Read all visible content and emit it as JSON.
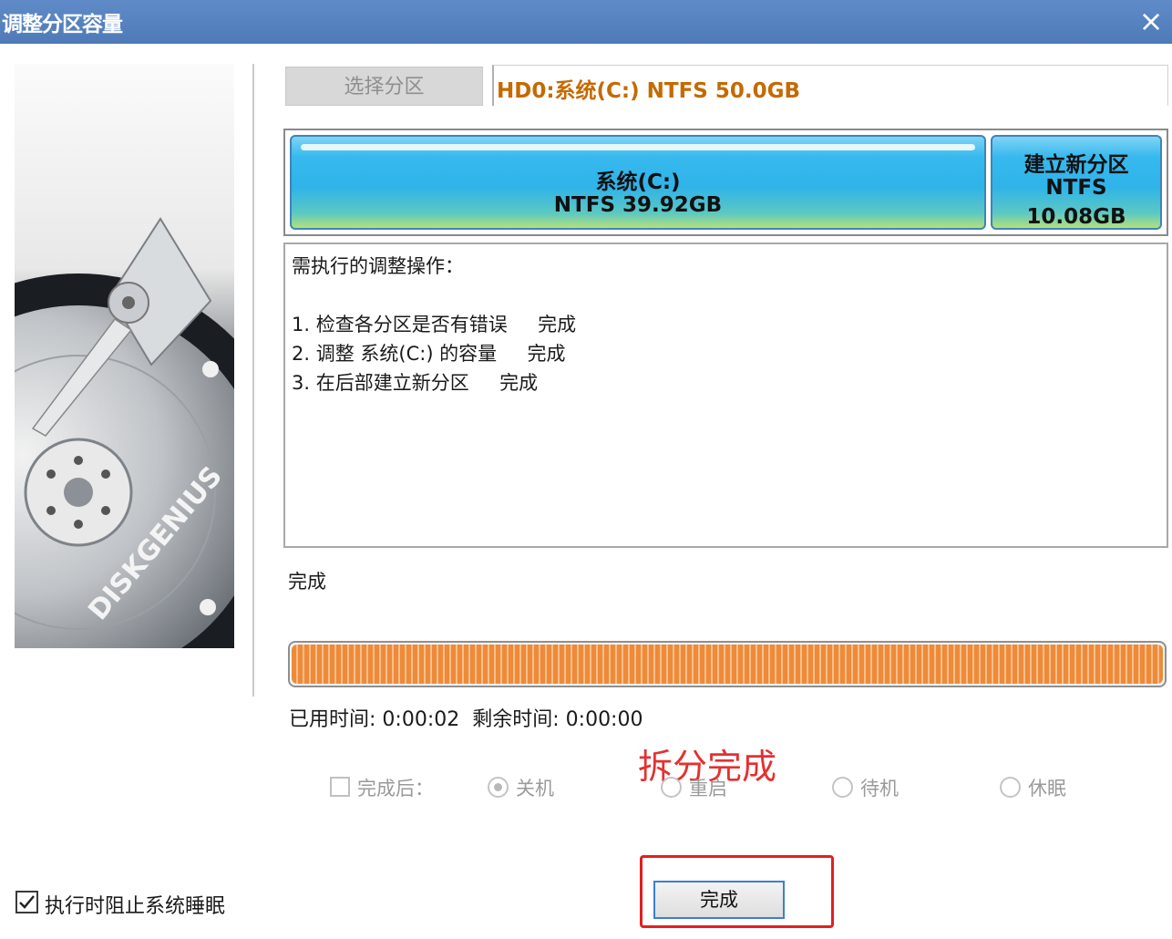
{
  "window": {
    "title": "调整分区容量",
    "close_label": "×"
  },
  "partition_select": {
    "button_label": "选择分区",
    "selected_value": "HD0:系统(C:) NTFS 50.0GB"
  },
  "partition_map": {
    "segments": [
      {
        "line1": "系统(C:)",
        "line2": "NTFS 39.92GB",
        "line3": ""
      },
      {
        "line1": "建立新分区",
        "line2": "NTFS",
        "line3": "10.08GB"
      }
    ]
  },
  "operations": {
    "heading": "需执行的调整操作：",
    "items": [
      "1. 检查各分区是否有错误     完成",
      "2. 调整 系统(C:) 的容量     完成",
      "3. 在后部建立新分区     完成"
    ]
  },
  "status_text": "完成",
  "progress": {
    "percent": 100
  },
  "timing": {
    "elapsed_label": "已用时间:",
    "elapsed_value": "0:00:02",
    "remaining_label": "剩余时间:",
    "remaining_value": "0:00:00"
  },
  "annotation": "拆分完成",
  "after_completion": {
    "label": "完成后：",
    "checked": false,
    "options": [
      {
        "label": "关机",
        "selected": true
      },
      {
        "label": "重启",
        "selected": false
      },
      {
        "label": "待机",
        "selected": false
      },
      {
        "label": "休眠",
        "selected": false
      }
    ]
  },
  "finish_button": {
    "label": "完成"
  },
  "prevent_sleep": {
    "label": "执行时阻止系统睡眠",
    "checked": true
  },
  "brand": {
    "logo_text": "DISKGENIUS",
    "accent_color": "#4f7ab8",
    "progress_color": "#ee8a3a",
    "annotation_color": "#e53030"
  }
}
